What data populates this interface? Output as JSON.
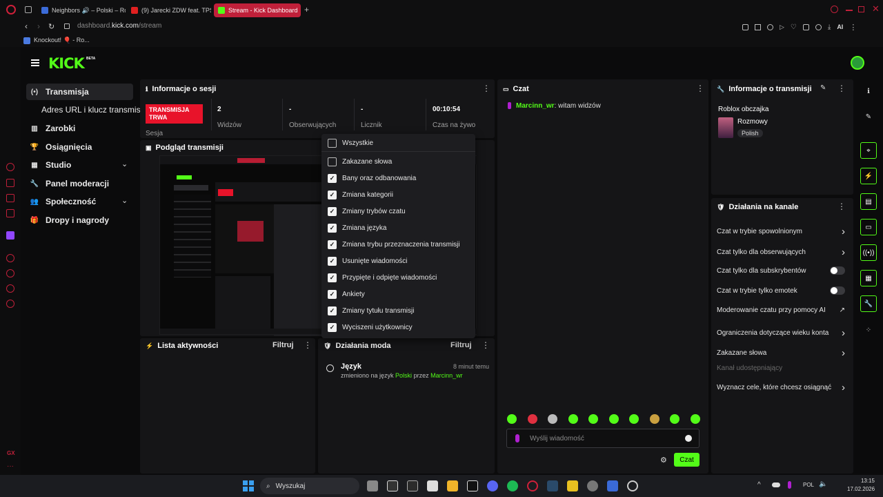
{
  "browser": {
    "tabs": [
      {
        "label": "Neighbors 🔊 – Polski – Ro",
        "color": "#3b6bd8"
      },
      {
        "label": "(9) Jarecki ZDW feat. TPS",
        "color": "#e02020"
      },
      {
        "label": "Stream - Kick Dashboard",
        "color": "#53fc18"
      }
    ],
    "url_prefix": "dashboard.",
    "url_domain": "kick.com",
    "url_path": "/stream",
    "bookmark": "Knockout! 🎈 - Ro...",
    "ai_label": "AI"
  },
  "kick": {
    "logo": "KICK",
    "beta": "BETA",
    "nav": [
      {
        "label": "Transmisja",
        "icon": "(•)",
        "name": "broadcast-icon"
      },
      {
        "label": "Adres URL i klucz transmisji",
        "icon": "",
        "name": "none"
      },
      {
        "label": "Zarobki",
        "icon": "▥",
        "name": "earnings-icon"
      },
      {
        "label": "Osiągnięcia",
        "icon": "🏆",
        "name": "trophy-icon"
      },
      {
        "label": "Studio",
        "icon": "▦",
        "name": "studio-icon"
      },
      {
        "label": "Panel moderacji",
        "icon": "🔧",
        "name": "wrench-icon"
      },
      {
        "label": "Społeczność",
        "icon": "👥",
        "name": "community-icon"
      },
      {
        "label": "Dropy i nagrody",
        "icon": "🎁",
        "name": "gift-icon"
      }
    ],
    "session": {
      "title": "Informacje o sesji",
      "status_badge": "TRANSMISJA TRWA",
      "session_label": "Sesja",
      "stats": [
        {
          "value": "2",
          "label": "Widzów"
        },
        {
          "value": "-",
          "label": "Obserwujących"
        },
        {
          "value": "-",
          "label": "Licznik"
        },
        {
          "value": "00:10:54",
          "label": "Czas na żywo"
        }
      ]
    },
    "preview": {
      "title": "Podgląd transmisji"
    },
    "activity": {
      "title": "Lista aktywności",
      "filter": "Filtruj"
    },
    "mod_actions": {
      "title": "Działania moda",
      "filter": "Filtruj",
      "item_title": "Język",
      "item_time": "8 minut temu",
      "item_text_1": "zmieniono na język ",
      "item_lang": "Polski",
      "item_text_2": " przez ",
      "item_user": "Marcinn_wr"
    },
    "filter_menu": [
      {
        "label": "Wszystkie",
        "checked": false
      },
      {
        "label": "Zakazane słowa",
        "checked": false
      },
      {
        "label": "Bany oraz odbanowania",
        "checked": true
      },
      {
        "label": "Zmiana kategorii",
        "checked": true
      },
      {
        "label": "Zmiany trybów czatu",
        "checked": true
      },
      {
        "label": "Zmiana języka",
        "checked": true
      },
      {
        "label": "Zmiana trybu przeznaczenia transmisji",
        "checked": true
      },
      {
        "label": "Usunięte wiadomości",
        "checked": true
      },
      {
        "label": "Przypięte i odpięte wiadomości",
        "checked": true
      },
      {
        "label": "Ankiety",
        "checked": true
      },
      {
        "label": "Zmiany tytułu transmisji",
        "checked": true
      },
      {
        "label": "Wyciszeni użytkownicy",
        "checked": true
      }
    ],
    "chat": {
      "title": "Czat",
      "message_user": "Marcinn_wr",
      "message_text": ": witam widzów",
      "input_placeholder": "Wyślij wiadomość",
      "send_label": "Czat"
    },
    "stream_info": {
      "title": "Informacje o transmisji",
      "stream_title": "Roblox obczajka",
      "category": "Rozmowy",
      "language": "Polish"
    },
    "channel_actions": {
      "title": "Działania na kanale",
      "items": [
        {
          "label": "Czat w trybie spowolnionym",
          "control": "chevron"
        },
        {
          "label": "Czat tylko dla obserwujących",
          "control": "chevron"
        },
        {
          "label": "Czat tylko dla subskrybentów",
          "control": "toggle"
        },
        {
          "label": "Czat w trybie tylko emotek",
          "control": "toggle"
        },
        {
          "label": "Moderowanie czatu przy pomocy AI",
          "control": "external"
        },
        {
          "label": "Ograniczenia dotyczące wieku konta",
          "control": "chevron"
        },
        {
          "label": "Zakazane słowa",
          "control": "chevron"
        },
        {
          "label": "Kanał udostępniający",
          "control": "none"
        },
        {
          "label": "Wyznacz cele, które chcesz osiągnąć",
          "control": "chevron"
        }
      ]
    }
  },
  "taskbar": {
    "search": "Wyszukaj",
    "lang": "POL",
    "time": "13:15",
    "date": "17.02.2026"
  },
  "colors": {
    "accent": "#53fc18",
    "live": "#e8132a",
    "opera": "#c0203a"
  }
}
